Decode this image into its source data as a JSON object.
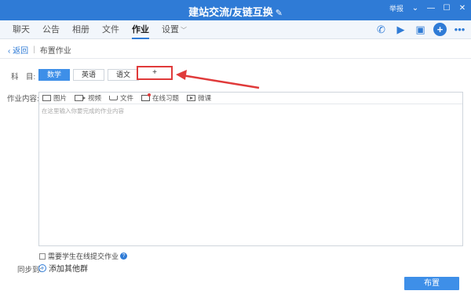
{
  "window": {
    "title": "建站交流/友链互换",
    "title_edit_icon": "pencil-icon",
    "report_label": "举报",
    "controls": [
      "chevron-down-icon",
      "minimize-icon",
      "maximize-icon",
      "close-icon"
    ]
  },
  "nav": {
    "tabs": [
      {
        "label": "聊天",
        "active": false
      },
      {
        "label": "公告",
        "active": false
      },
      {
        "label": "相册",
        "active": false
      },
      {
        "label": "文件",
        "active": false
      },
      {
        "label": "作业",
        "active": true
      },
      {
        "label": "设置",
        "active": false,
        "has_dropdown": true
      }
    ],
    "icons": [
      "phone-icon",
      "video-call-icon",
      "whiteboard-icon",
      "add-icon",
      "more-icon"
    ]
  },
  "breadcrumb": {
    "back_label": "返回",
    "separator": "|",
    "current": "布置作业"
  },
  "form": {
    "subject_label": "科　目:",
    "subjects": [
      {
        "label": "数学",
        "active": true
      },
      {
        "label": "英语",
        "active": false
      },
      {
        "label": "语文",
        "active": false
      }
    ],
    "add_subject_label": "+",
    "content_label": "作业内容:",
    "toolbar": [
      {
        "label": "图片",
        "icon": "image-icon"
      },
      {
        "label": "视频",
        "icon": "video-icon"
      },
      {
        "label": "文件",
        "icon": "file-tray-icon"
      },
      {
        "label": "在线习题",
        "icon": "online-exercise-icon"
      },
      {
        "label": "微课",
        "icon": "micro-lesson-icon"
      }
    ],
    "content_placeholder": "在这里输入你要完成的作业内容",
    "require_online_submit_label": "需要学生在线提交作业",
    "require_online_submit_checked": false,
    "sync_label": "同步到:",
    "add_group_label": "添加其他群",
    "submit_label": "布置"
  },
  "annotation": {
    "highlight_color": "#e03a3a"
  },
  "colors": {
    "title_bar": "#2f7bd6",
    "accent": "#3e8fe8"
  }
}
